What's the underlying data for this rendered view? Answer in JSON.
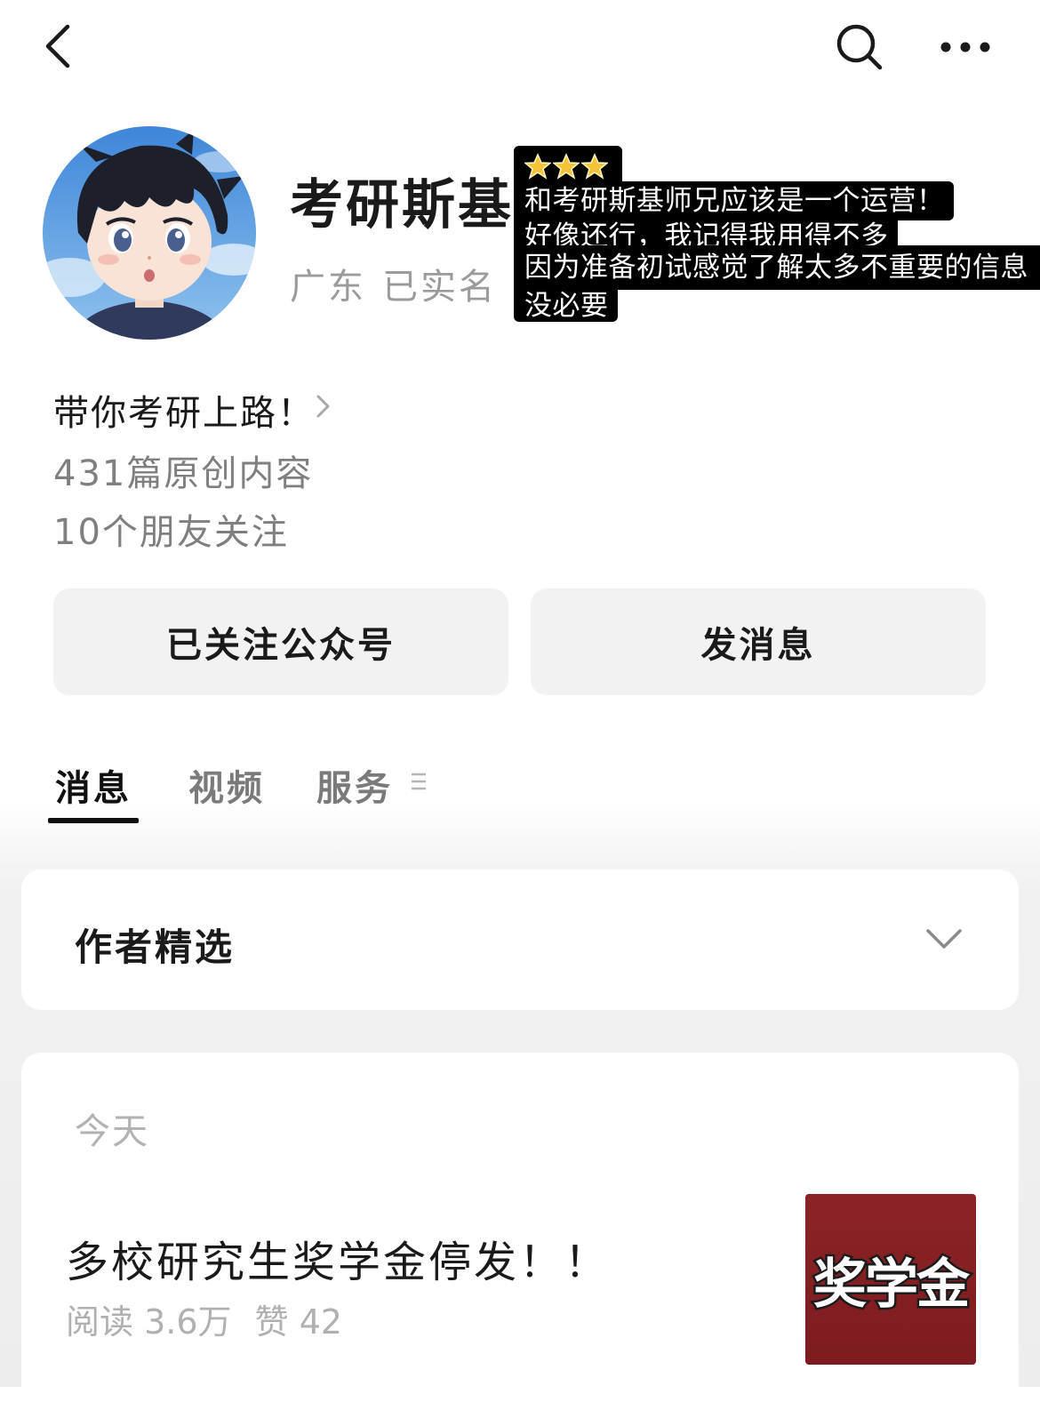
{
  "topbar": {
    "back_icon": "chevron-left-icon",
    "search_icon": "search-icon",
    "more_icon": "more-dots-icon"
  },
  "profile": {
    "nickname": "考研斯基",
    "region": "广东",
    "verification": "已实名",
    "avatar_icon": "anime-boy-avatar"
  },
  "overlay_note": {
    "stars": "⭐⭐⭐",
    "lines": [
      "和考研斯基师兄应该是一个运营！",
      "好像还行，我记得我用得不多",
      "因为准备初试感觉了解太多不重要的信息",
      "没必要"
    ]
  },
  "intro": {
    "signature": "带你考研上路！",
    "original_count": "431篇原创内容",
    "friends_following": "10个朋友关注"
  },
  "actions": {
    "follow_label": "已关注公众号",
    "message_label": "发消息"
  },
  "tabs": [
    {
      "label": "消息",
      "active": true
    },
    {
      "label": "视频",
      "active": false
    },
    {
      "label": "服务",
      "active": false
    }
  ],
  "featured": {
    "title": "作者精选"
  },
  "articles": {
    "date_label": "今天",
    "items": [
      {
        "title": "多校研究生奖学金停发！！",
        "reads": "阅读 3.6万",
        "likes": "赞 42",
        "thumb_text": "奖学金",
        "thumb_color": "#8b2325"
      }
    ]
  }
}
